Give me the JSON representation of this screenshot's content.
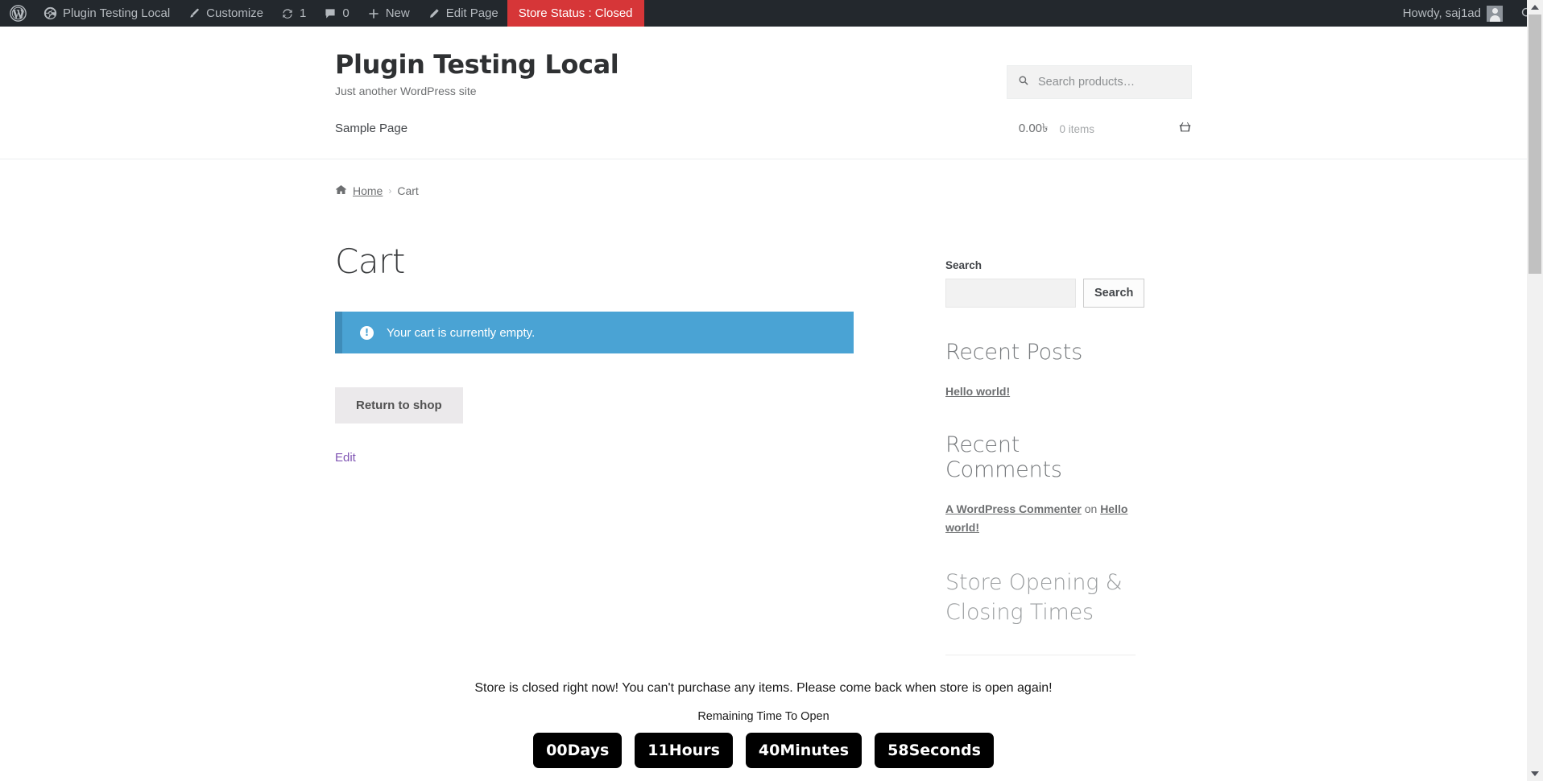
{
  "adminbar": {
    "logo_icon": "wordpress-logo-icon",
    "site_name": "Plugin Testing Local",
    "site_icon": "dashboard-icon",
    "customize": "Customize",
    "customize_icon": "paintbrush-icon",
    "updates_count": "1",
    "updates_icon": "update-arrows-icon",
    "comments_count": "0",
    "comments_icon": "comment-bubble-icon",
    "new": "New",
    "new_icon": "plus-icon",
    "edit_page": "Edit Page",
    "edit_icon": "pencil-icon",
    "store_status": "Store Status : Closed",
    "store_status_color": "#d63638",
    "howdy": "Howdy, saj1ad",
    "avatar_icon": "user-avatar-icon",
    "search_icon": "search-icon"
  },
  "header": {
    "title": "Plugin Testing Local",
    "description": "Just another WordPress site",
    "product_search": {
      "placeholder": "Search products…",
      "value": "",
      "icon": "search-icon"
    },
    "menu": [
      {
        "label": "Sample Page"
      }
    ],
    "cart": {
      "amount": "0.00৳",
      "items": "0 items",
      "icon": "shopping-basket-icon"
    }
  },
  "breadcrumb": {
    "home_icon": "home-icon",
    "home": "Home",
    "separator": "›",
    "current": "Cart"
  },
  "main": {
    "page_title": "Cart",
    "notice": {
      "icon": "info-circle-icon",
      "text": "Your cart is currently empty.",
      "bg_color": "#4aa3d4",
      "border_color": "#3e8cb9"
    },
    "return_button": "Return to shop",
    "edit_link": "Edit"
  },
  "sidebar": {
    "search_widget": {
      "title": "Search",
      "value": "",
      "button": "Search"
    },
    "recent_posts": {
      "title": "Recent Posts",
      "items": [
        {
          "label": "Hello world!"
        }
      ]
    },
    "recent_comments": {
      "title": "Recent Comments",
      "items": [
        {
          "author": "A WordPress Commenter",
          "on": "on",
          "post": "Hello world!"
        }
      ]
    },
    "store_hours": {
      "title": "Store Opening & Closing Times"
    }
  },
  "store_closed": {
    "message": "Store is closed right now! You can't purchase any items. Please come back when store is open again!",
    "remaining_label": "Remaining Time To Open",
    "countdown": [
      {
        "value": "00",
        "unit": "Days"
      },
      {
        "value": "11",
        "unit": "Hours"
      },
      {
        "value": "40",
        "unit": "Minutes"
      },
      {
        "value": "58",
        "unit": "Seconds"
      }
    ]
  }
}
